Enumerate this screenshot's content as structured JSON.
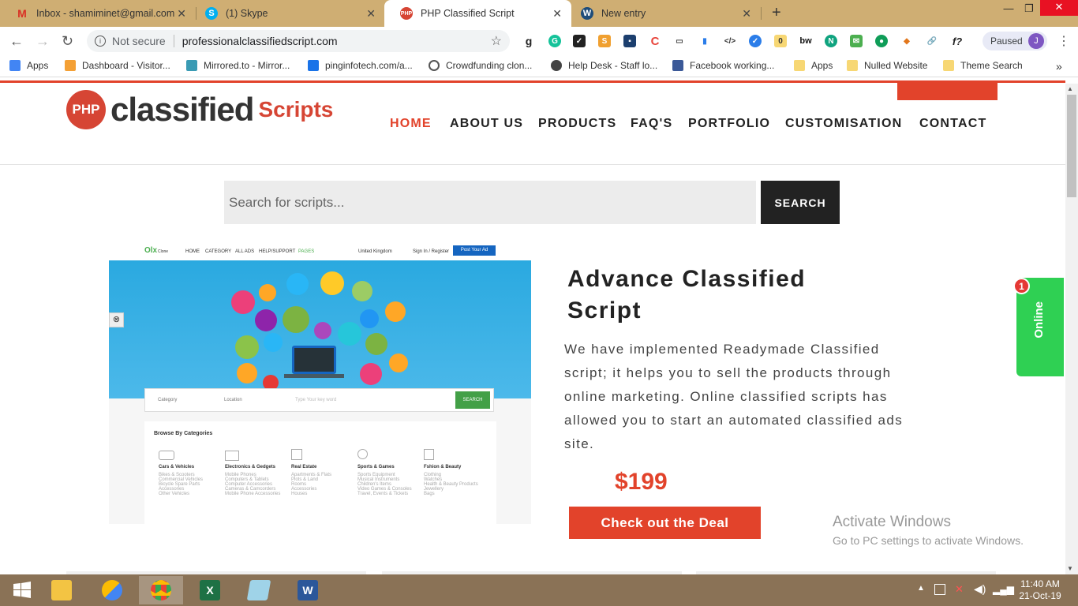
{
  "tabs": [
    {
      "label": "Inbox - shamiminet@gmail.com",
      "icon": "gmail-icon"
    },
    {
      "label": "(1) Skype",
      "icon": "skype-icon"
    },
    {
      "label": "PHP Classified Script",
      "icon": "php-icon"
    },
    {
      "label": "New entry",
      "icon": "wordpress-icon"
    }
  ],
  "toolbar": {
    "security": "Not secure",
    "url": "professionalclassifiedscript.com",
    "profile_status": "Paused",
    "profile_initial": "J"
  },
  "bookmarks": [
    {
      "label": "Apps",
      "color": "#4285f4"
    },
    {
      "label": "Dashboard - Visitor...",
      "color": "#f4a035"
    },
    {
      "label": "Mirrored.to - Mirror...",
      "color": "#3a9bb4"
    },
    {
      "label": "pinginfotech.com/a...",
      "color": "#1a73e8"
    },
    {
      "label": "Crowdfunding clon...",
      "color": "#555555"
    },
    {
      "label": "Help Desk - Staff lo...",
      "color": "#444444"
    },
    {
      "label": "Facebook working...",
      "color": "#3b5998"
    },
    {
      "label": "Apps",
      "color": "#f7d774"
    },
    {
      "label": "Nulled Website",
      "color": "#f7d774"
    },
    {
      "label": "Theme Search",
      "color": "#f7d774"
    }
  ],
  "site": {
    "logo": {
      "badge": "PHP",
      "word": "classified",
      "suffix": "Scripts"
    },
    "nav": [
      "HOME",
      "ABOUT US",
      "PRODUCTS",
      "FAQ'S",
      "PORTFOLIO",
      "CUSTOMISATION",
      "CONTACT"
    ],
    "search_placeholder": "Search for scripts...",
    "search_button": "SEARCH",
    "product": {
      "title": "Advance Classified Script",
      "description": "We have implemented Readymade Classified script; it helps you to sell the products through online marketing. Online classified scripts has allowed you to start an automated classified ads site.",
      "price": "$199",
      "cta": "Check out the Deal"
    },
    "chat": {
      "label": "Online",
      "badge": "1"
    }
  },
  "preview": {
    "brand": "Olx",
    "brand_suffix": "Clone",
    "nav": [
      "HOME",
      "CATEGORY",
      "ALL ADS",
      "HELP/SUPPORT",
      "PAGES"
    ],
    "country": "United Kingdom",
    "signin": "Sign In / Register",
    "post": "Post Your Ad",
    "category": "Category",
    "location": "Location",
    "keyword": "Type Your key word",
    "search": "SEARCH",
    "browse": "Browse By Categories",
    "categories": [
      {
        "name": "Cars & Vehicles",
        "items": [
          "Bikes & Scooters",
          "Commercial Vehicles",
          "Bicycle Spare Parts",
          "Accessories",
          "Other Vehicles"
        ]
      },
      {
        "name": "Electronics & Gedgets",
        "items": [
          "Mobile Phones",
          "Computers & Tablets",
          "Computer Accessories",
          "Cameras & Camcorders",
          "Mobile Phone Accessories"
        ]
      },
      {
        "name": "Real Estate",
        "items": [
          "Apartments & Flats",
          "Plots & Land",
          "Rooms",
          "Accessories",
          "Houses"
        ]
      },
      {
        "name": "Sports & Games",
        "items": [
          "Sports Equipment",
          "Musical Instruments",
          "Children's Items",
          "Video Games & Consoles",
          "Travel, Events & Tickets"
        ]
      },
      {
        "name": "Fshion & Beauty",
        "items": [
          "Clothing",
          "Watches",
          "Health & Beauty Products",
          "Jewellery",
          "Bags"
        ]
      }
    ]
  },
  "watermark": {
    "line1": "Activate Windows",
    "line2": "Go to PC settings to activate Windows."
  },
  "clock": {
    "time": "11:40 AM",
    "date": "21-Oct-19"
  },
  "colors": {
    "accent": "#e2432b",
    "online": "#2fd053",
    "tabbar": "#cfae73"
  }
}
